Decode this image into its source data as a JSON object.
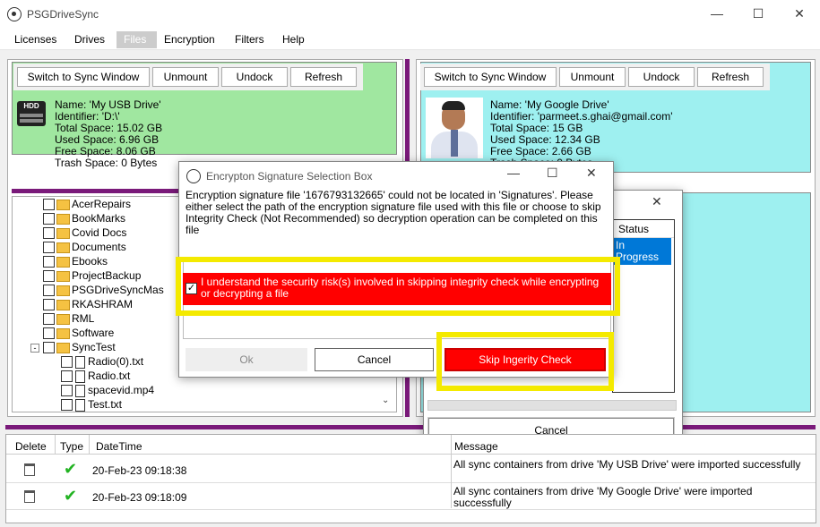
{
  "window": {
    "title": "PSGDriveSync"
  },
  "menu": [
    "Licenses",
    "Drives",
    "Files",
    "Encryption",
    "Filters",
    "Help"
  ],
  "left_panel": {
    "buttons": [
      "Switch to Sync Window",
      "Unmount",
      "Undock",
      "Refresh"
    ],
    "drive_icon_text": "HDD",
    "drive_info": [
      "Name: 'My USB Drive'",
      "Identifier: 'D:\\'",
      "Total Space: 15.02 GB",
      "Used Space: 6.96 GB",
      "Free Space: 8.06 GB",
      "Trash Space: 0 Bytes"
    ],
    "folders": [
      "AcerRepairs",
      "BookMarks",
      "Covid Docs",
      "Documents",
      "Ebooks",
      "ProjectBackup",
      "PSGDriveSyncMas",
      "RKASHRAM",
      "RML",
      "Software",
      "SyncTest"
    ],
    "files": [
      "Radio(0).txt",
      "Radio.txt",
      "spacevid.mp4",
      "Test.txt"
    ],
    "colors": {
      "bg": "#a0e7a0"
    }
  },
  "right_panel": {
    "buttons": [
      "Switch to Sync Window",
      "Unmount",
      "Undock",
      "Refresh"
    ],
    "drive_info": [
      "Name: 'My Google Drive'",
      "Identifier: 'parmeet.s.ghai@gmail.com'",
      "Total Space: 15 GB",
      "Used Space: 12.34 GB",
      "Free Space: 2.66 GB",
      "Trash Space: 0 Bytes"
    ],
    "colors": {
      "bg": "#9ef0f0"
    }
  },
  "progress_dialog": {
    "status_header": "Status",
    "status_value": "In Progress",
    "cancel_label": "Cancel"
  },
  "encryption_dialog": {
    "title": "Encrypton Signature Selection Box",
    "message": "Encryption signature file '1676793132665' could not be located in 'Signatures'. Please either select the path of the encryption signature file used with this file or choose to skip Integrity Check (Not Recommended) so decryption operation can be completed on this file",
    "checkbox_label": "I understand the security risk(s) involved in skipping integrity check while encrypting or decrypting a file",
    "checkbox_checked": true,
    "ok_label": "Ok",
    "cancel_label": "Cancel",
    "skip_label": "Skip Ingerity Check",
    "colors": {
      "warning": "#ff0000",
      "highlight": "#f4ea00"
    }
  },
  "log": {
    "headers": [
      "Delete",
      "Type",
      "DateTime",
      "Message"
    ],
    "rows": [
      {
        "datetime": "20-Feb-23 09:18:38",
        "message": "All sync containers from drive 'My USB Drive' were imported successfully"
      },
      {
        "datetime": "20-Feb-23 09:18:09",
        "message": "All sync containers from drive 'My Google Drive' were imported successfully"
      }
    ]
  }
}
